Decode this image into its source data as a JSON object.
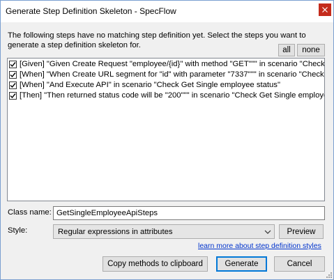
{
  "window": {
    "title": "Generate Step Definition Skeleton - SpecFlow"
  },
  "instructions": "The following steps have no matching step definition yet. Select the steps you want to generate a step definition skeleton for.",
  "select_buttons": {
    "all": "all",
    "none": "none"
  },
  "steps": [
    {
      "text": "[Given] \"Given Create Request \"employee/{id}\" with method \"GET\"\"\" in scenario \"Check Ge",
      "checked": true
    },
    {
      "text": "[When] \"When Create URL segment for \"id\" with parameter \"7337\"\"\" in scenario \"Check Ge",
      "checked": true
    },
    {
      "text": "[When] \"And Execute API\" in scenario \"Check Get Single employee status\"",
      "checked": true
    },
    {
      "text": "[Then] \"Then returned status code will be \"200\"\"\" in scenario \"Check Get Single employee s",
      "checked": true
    }
  ],
  "class_name": {
    "label": "Class name:",
    "value": "GetSingleEmployeeApiSteps"
  },
  "style": {
    "label": "Style:",
    "selected": "Regular expressions in attributes",
    "preview_label": "Preview"
  },
  "learn_more_link": "learn more about step definition styles",
  "actions": {
    "copy": "Copy methods to clipboard",
    "generate": "Generate",
    "cancel": "Cancel"
  },
  "colors": {
    "close_button": "#c42b1c",
    "default_button_border": "#0078d7",
    "link": "#0033cc"
  }
}
